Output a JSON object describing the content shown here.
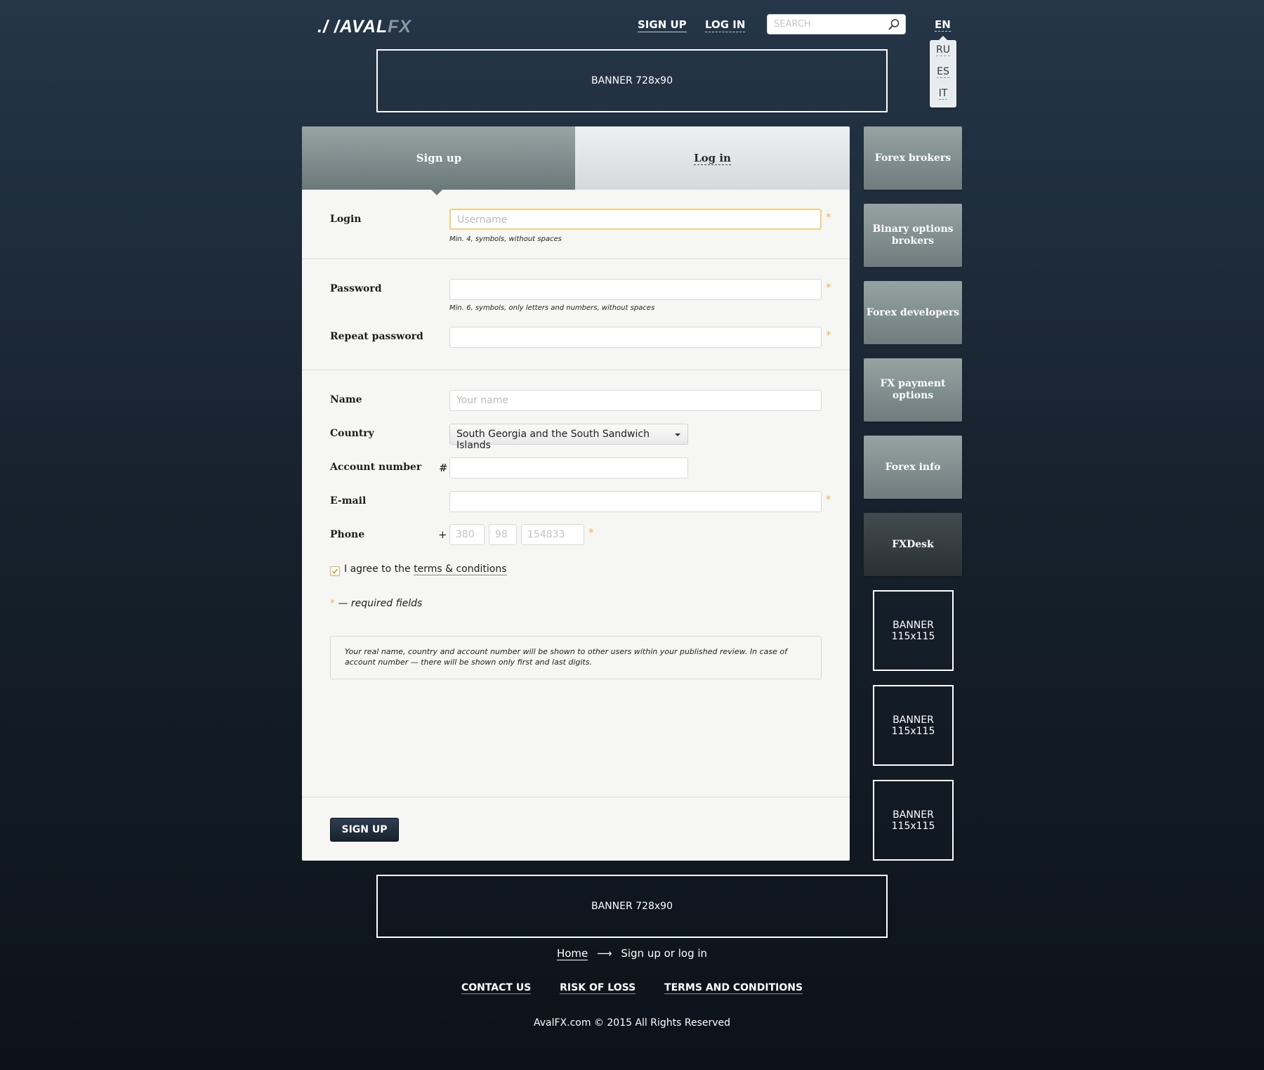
{
  "header": {
    "logo_main": "AVAL",
    "logo_accent": "FX",
    "nav": {
      "signup": "SIGN UP",
      "login": "LOG IN"
    },
    "search_placeholder": "SEARCH",
    "lang_current": "EN",
    "lang_options": [
      "RU",
      "ES",
      "IT"
    ]
  },
  "banners": {
    "top": "BANNER 728x90",
    "bottom": "BANNER 728x90",
    "side": [
      "BANNER 115x115",
      "BANNER 115x115",
      "BANNER 115x115"
    ]
  },
  "tabs": {
    "signup": "Sign up",
    "login": "Log in"
  },
  "form": {
    "login": {
      "label": "Login",
      "placeholder": "Username",
      "hint": "Min. 4, symbols, without spaces"
    },
    "password": {
      "label": "Password",
      "hint": "Min. 6, symbols, only letters and numbers, without spaces"
    },
    "repeat_password": {
      "label": "Repeat password"
    },
    "name": {
      "label": "Name",
      "placeholder": "Your name"
    },
    "country": {
      "label": "Country",
      "value": "South Georgia and the South Sandwich Islands"
    },
    "account": {
      "label": "Account number",
      "prefix": "#"
    },
    "email": {
      "label": "E-mail"
    },
    "phone": {
      "label": "Phone",
      "prefix": "+",
      "code": "380",
      "operator": "98",
      "number": "154833"
    },
    "required_mark": "*",
    "agree_text": "I agree to the",
    "agree_link": "terms & conditions",
    "required_note": "— required fields",
    "info": "Your real name, country and account number will be shown to other users within your published review. In case of account number — there will be shown only first and last digits.",
    "submit": "SIGN UP"
  },
  "sidebar": [
    "Forex brokers",
    "Binary options brokers",
    "Forex developers",
    "FX payment options",
    "Forex info",
    "FXDesk"
  ],
  "footer": {
    "breadcrumb_home": "Home",
    "breadcrumb_arrow": "⟶",
    "breadcrumb_current": "Sign up or log in",
    "links": [
      "CONTACT US",
      "RISK OF LOSS",
      "TERMS AND CONDITIONS"
    ],
    "copyright": "AvalFX.com © 2015 All Rights Reserved"
  }
}
